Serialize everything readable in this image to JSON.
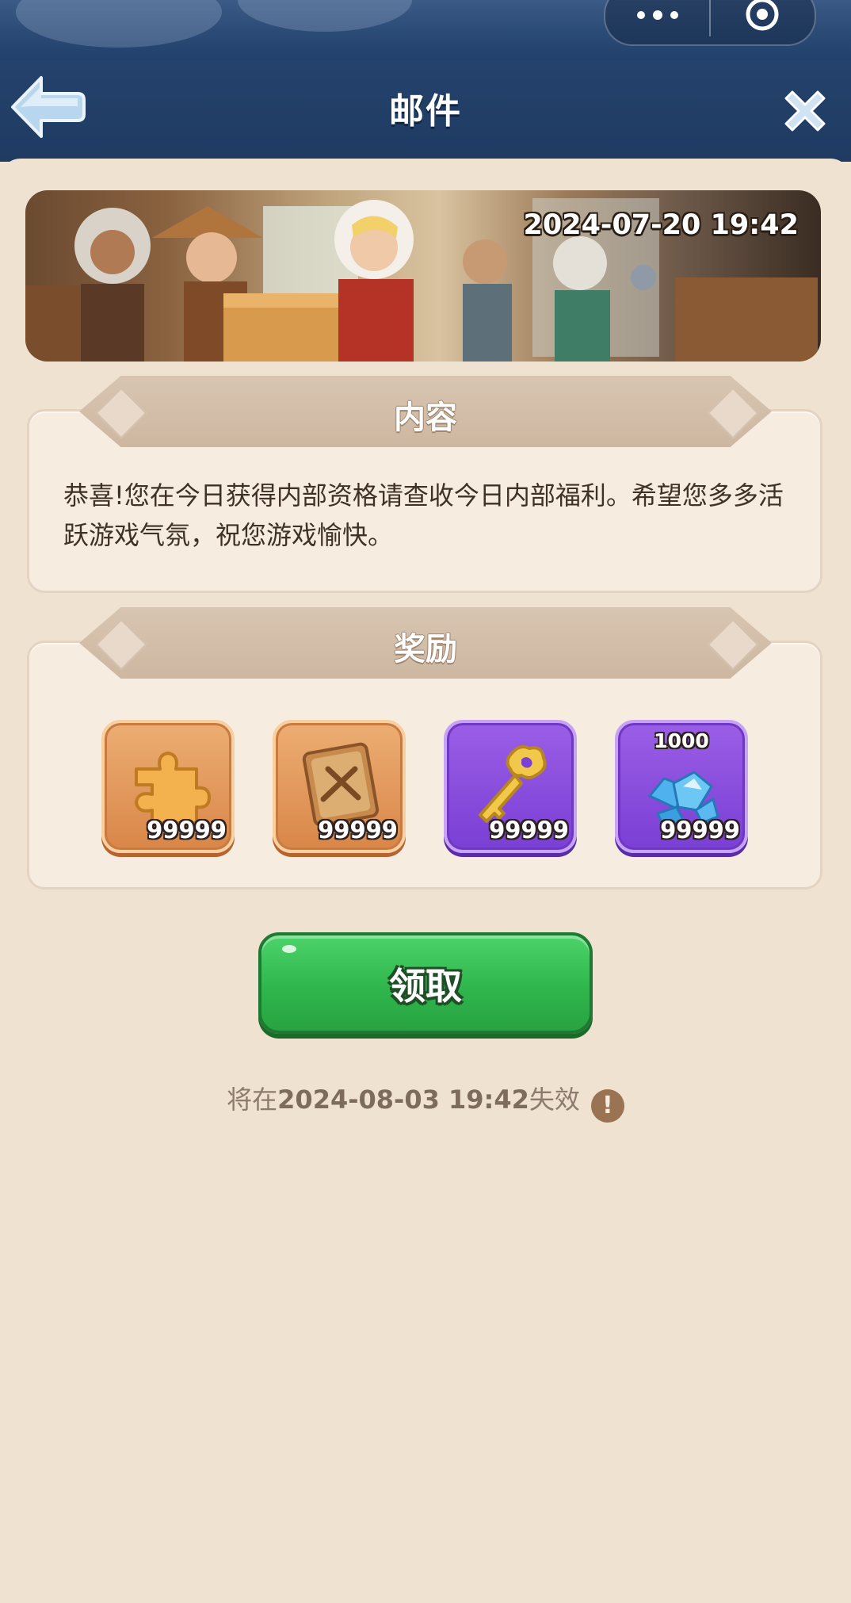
{
  "header": {
    "title": "邮件",
    "back_icon": "back-arrow-icon",
    "close_icon": "close-icon"
  },
  "mini_program_capsule": {
    "more_icon": "more-dots-icon",
    "exit_icon": "target-circle-icon"
  },
  "banner": {
    "date": "2024-07-20 19:42"
  },
  "content_section": {
    "title": "内容",
    "message": "恭喜!您在今日获得内部资格请查收今日内部福利。希望您多多活跃游戏气氛，祝您游戏愉快。"
  },
  "rewards_section": {
    "title": "奖励",
    "items": [
      {
        "icon": "puzzle-piece-icon",
        "count": "99999",
        "rarity": "orange"
      },
      {
        "icon": "sword-book-icon",
        "count": "99999",
        "rarity": "orange"
      },
      {
        "icon": "golden-key-icon",
        "count": "99999",
        "rarity": "purple"
      },
      {
        "icon": "blue-gem-pile-icon",
        "count": "99999",
        "top_label": "1000",
        "rarity": "purple"
      }
    ]
  },
  "claim_button": {
    "label": "领取"
  },
  "expiry": {
    "prefix": "将在",
    "date": "2024-08-03 19:42",
    "suffix": "失效",
    "info_icon": "exclamation-info-icon"
  },
  "colors": {
    "header_bg": "#1f3b62",
    "panel_bg": "#efe2d1",
    "claim_green": "#2fb64c",
    "orange_frame": "#d98648",
    "purple_frame": "#7a3fd4"
  }
}
